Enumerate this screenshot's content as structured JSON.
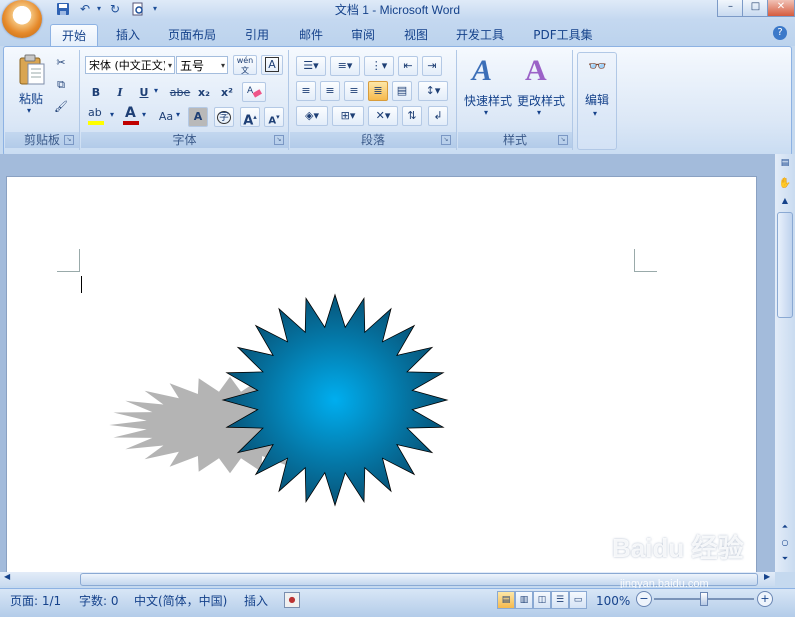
{
  "window": {
    "title": "文档 1 - Microsoft Word",
    "minimize": "–",
    "maximize": "□",
    "close": "✕"
  },
  "office_button": {
    "logo": "W"
  },
  "quick_access": [
    "save-icon",
    "undo-icon",
    "redo-icon",
    "print-preview-icon",
    "customize-icon"
  ],
  "tabs": [
    {
      "label": "开始",
      "active": true
    },
    {
      "label": "插入"
    },
    {
      "label": "页面布局"
    },
    {
      "label": "引用"
    },
    {
      "label": "邮件"
    },
    {
      "label": "审阅"
    },
    {
      "label": "视图"
    },
    {
      "label": "开发工具"
    },
    {
      "label": "PDF工具集"
    }
  ],
  "help": "?",
  "clipboard": {
    "paste_label": "粘贴",
    "group_label": "剪贴板"
  },
  "font": {
    "font_name": "宋体 (中文正文)",
    "font_size": "五号",
    "wen_label": "wén",
    "bold": "B",
    "italic": "I",
    "underline": "U",
    "strike": "abe",
    "subscript": "x₂",
    "superscript": "x²",
    "font_color": "A",
    "case": "Aa",
    "char_shade": "A",
    "enclose": "字",
    "grow": "A",
    "shrink": "A",
    "group_label": "字体"
  },
  "paragraph": {
    "group_label": "段落"
  },
  "styles": {
    "quick_styles": "快速样式",
    "change_styles": "更改样式",
    "group_label": "样式"
  },
  "editing": {
    "label": "编辑"
  },
  "status": {
    "page": "页面: 1/1",
    "words": "字数: 0",
    "language": "中文(简体，中国)",
    "mode": "插入",
    "zoom": "100%"
  },
  "watermark": {
    "text": "Baidu 经验",
    "sub": "jingyan.baidu.com"
  },
  "colors": {
    "shape_center": "#00aeef",
    "shape_edge": "#084a6b",
    "shadow": "#b4b4b4",
    "ribbon_bg": "#dbe7f6"
  }
}
